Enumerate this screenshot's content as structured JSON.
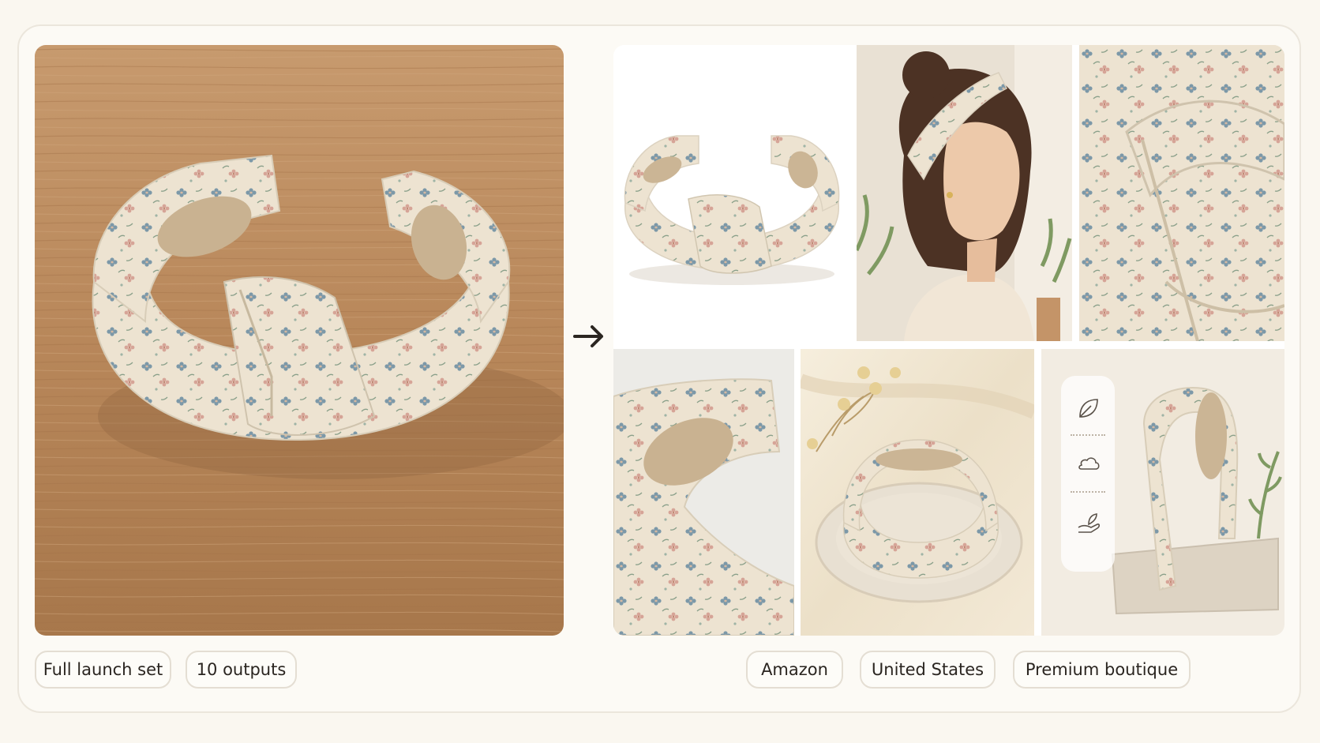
{
  "left_panel": {
    "hero_image": "knotted-floral-headband-on-wood-table",
    "tags": [
      "Full launch set",
      "10 outputs"
    ]
  },
  "transform_arrow_icon": "arrow-right-icon",
  "outputs": {
    "images": [
      "headband-white-background",
      "model-wearing-headband",
      "knot-closeup",
      "fabric-edge-closeup",
      "headband-on-ceramic-dish",
      "headband-on-stone-with-feature-icons"
    ],
    "feature_icons": [
      "leaf-icon",
      "cloud-icon",
      "hand-plant-icon"
    ]
  },
  "right_panel": {
    "tags": [
      "Amazon",
      "United States",
      "Premium boutique"
    ]
  },
  "colors": {
    "page_background": "#faf7f0",
    "frame_border": "#ebe6dc",
    "pill_border": "#e4ded3",
    "fabric_cream": "#ece2d0",
    "floral_blue": "#7c98a8",
    "floral_pink": "#d6a497",
    "wood": "#b8875a"
  }
}
